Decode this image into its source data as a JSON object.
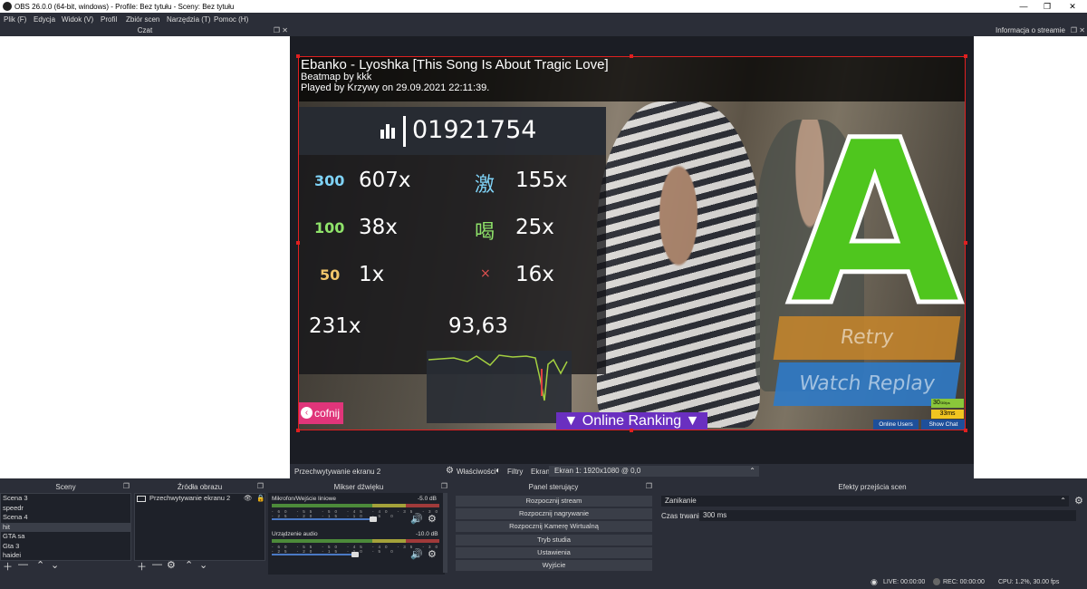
{
  "window": {
    "title": "OBS 26.0.0 (64-bit, windows) - Profile: Bez tytułu - Sceny: Bez tytułu",
    "min": "—",
    "max": "❐",
    "close": "✕"
  },
  "menu": [
    "Plik (F)",
    "Edycja",
    "Widok (V)",
    "Profil",
    "Zbiór scen",
    "Narzędzia (T)",
    "Pomoc (H)"
  ],
  "docks": {
    "chat": "Czat",
    "stream_info": "Informacja o streamie"
  },
  "game": {
    "song_title": "Ebanko - Lyoshka [This Song Is About Tragic Love]",
    "beatmap": "Beatmap by kkk",
    "played_by": "Played by Krzywy on 29.09.2021 22:11:39.",
    "score": "01921754",
    "h300_label": "300",
    "h300_count": "607x",
    "geki_label": "激",
    "geki_count": "155x",
    "h100_label": "100",
    "h100_count": "38x",
    "katu_label": "喝",
    "katu_count": "25x",
    "h50_label": "50",
    "h50_count": "1x",
    "miss_label": "×",
    "miss_count": "16x",
    "combo": "231x",
    "accuracy": "93,63",
    "grade": "A",
    "retry": "Retry",
    "watch_replay": "Watch Replay",
    "back": "cofnij",
    "online_ranking": "▼ Online Ranking ▼",
    "fps": "30",
    "fps_unit": "/30fps",
    "latency": "33ms",
    "online_users": "Online Users",
    "show_chat": "Show Chat",
    "colors": {
      "h300": "#7fd3f7",
      "h100": "#8fe36a",
      "h50": "#f1c56a",
      "miss": "#e05050",
      "grade": "#4fc61e",
      "retry_bg": "#c8862a",
      "replay_bg": "#2f7ac7"
    }
  },
  "source_bar": {
    "selected": "Przechwytywanie ekranu 2",
    "properties": "Właściwości",
    "filters": "Filtry",
    "screen_label": "Ekran",
    "screen_value": "Ekran 1: 1920x1080 @ 0,0"
  },
  "scenes": {
    "title": "Sceny",
    "items": [
      "Scena 3",
      "speedr",
      "Scena 4",
      "hit",
      "GTA sa",
      "Gta 3",
      "haidei"
    ],
    "selected": "hit"
  },
  "sources": {
    "title": "Źródła obrazu",
    "items": [
      "Przechwytywanie ekranu 2"
    ]
  },
  "mixer": {
    "title": "Mikser dźwięku",
    "channels": [
      {
        "name": "Mikrofon/Wejście liniowe",
        "db": "-5.0 dB",
        "level": 0.75
      },
      {
        "name": "Urządzenie audio",
        "db": "-10.0 dB",
        "level": 0.6
      }
    ],
    "scale": "-60 -55 -50 -45 -40 -35 -30 -25 -20 -15 -10 -5 0"
  },
  "controls": {
    "title": "Panel sterujący",
    "buttons": [
      "Rozpocznij stream",
      "Rozpocznij nagrywanie",
      "Rozpocznij Kamerę Wirtualną",
      "Tryb studia",
      "Ustawienia",
      "Wyjście"
    ]
  },
  "transitions": {
    "title": "Efekty przejścia scen",
    "effect": "Zanikanie",
    "duration_label": "Czas trwania",
    "duration": "300 ms"
  },
  "status": {
    "live": "LIVE: 00:00:00",
    "rec": "REC: 00:00:00",
    "cpu": "CPU: 1.2%, 30.00 fps"
  }
}
